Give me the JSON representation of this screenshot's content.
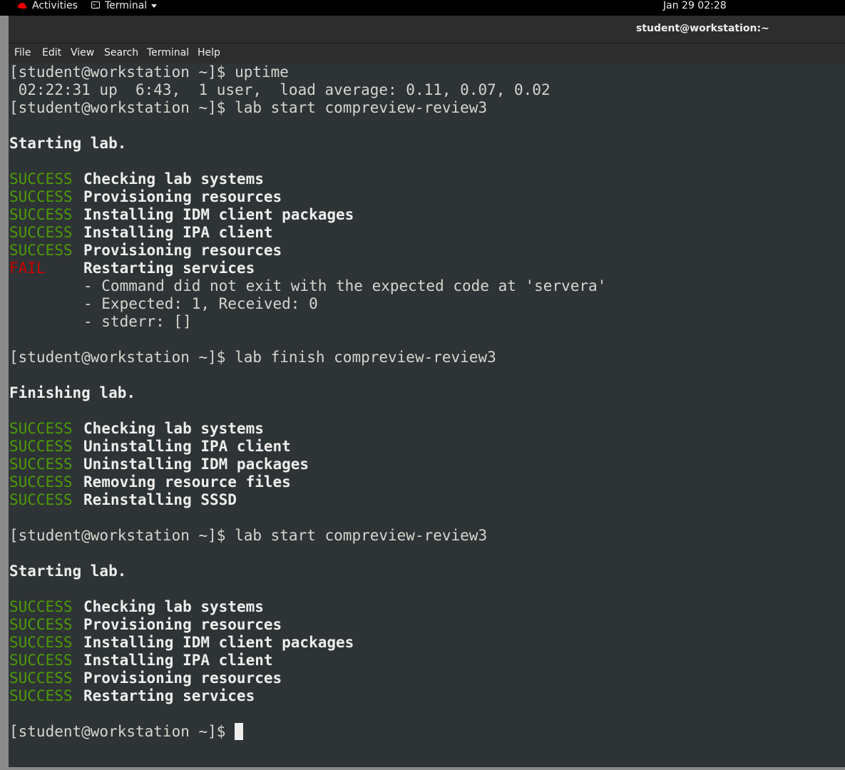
{
  "topbar": {
    "activities": "Activities",
    "app_menu": "Terminal",
    "clock": "Jan 29 02:28"
  },
  "window": {
    "title": "student@workstation:~"
  },
  "menubar": {
    "items": [
      "File",
      "Edit",
      "View",
      "Search",
      "Terminal",
      "Help"
    ]
  },
  "terminal": {
    "prompt": "[student@workstation ~]$ ",
    "cmd1": "uptime",
    "uptime_output": " 02:22:31 up  6:43,  1 user,  load average: 0.11, 0.07, 0.02",
    "cmd_start": "lab start compreview-review3",
    "cmd_finish": "lab finish compreview-review3",
    "starting": "Starting lab.",
    "finishing": "Finishing lab.",
    "success": "SUCCESS",
    "fail": "FAIL",
    "start1": [
      "Checking lab systems",
      "Provisioning resources",
      "Installing IDM client packages",
      "Installing IPA client",
      "Provisioning resources"
    ],
    "fail_step": "Restarting services",
    "fail_details": [
      "- Command did not exit with the expected code at 'servera'",
      "- Expected: 1, Received: 0",
      "- stderr: []"
    ],
    "finish": [
      "Checking lab systems",
      "Uninstalling IPA client",
      "Uninstalling IDM packages",
      "Removing resource files",
      "Reinstalling SSSD"
    ],
    "start2": [
      "Checking lab systems",
      "Provisioning resources",
      "Installing IDM client packages",
      "Installing IPA client",
      "Provisioning resources",
      "Restarting services"
    ]
  },
  "colors": {
    "success": "#4e9a06",
    "fail": "#cc0000",
    "terminal_bg": "#2e3436"
  }
}
